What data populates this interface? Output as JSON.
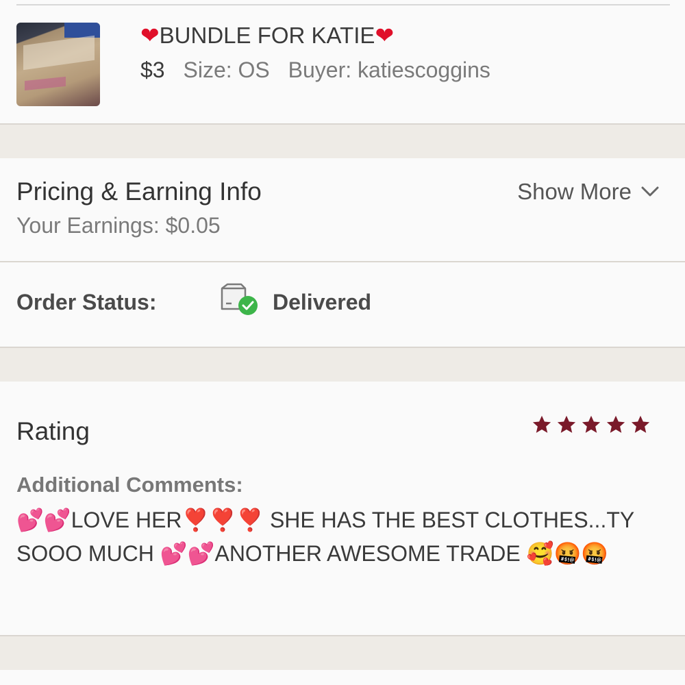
{
  "item": {
    "title": "BUNDLE FOR KATIE",
    "price": "$3",
    "size": "Size: OS",
    "buyer": "Buyer: katiescoggins"
  },
  "pricing": {
    "title": "Pricing & Earning Info",
    "earnings": "Your Earnings: $0.05",
    "show_more": "Show More"
  },
  "order_status": {
    "label": "Order Status:",
    "value": "Delivered"
  },
  "rating": {
    "title": "Rating",
    "stars": 5,
    "star_color": "#7a1a2a",
    "comments_label": "Additional Comments:",
    "comments": "💕💕LOVE HER❣️❣️❣️ SHE HAS THE BEST CLOTHES...TY SOOO MUCH 💕💕ANOTHER AWESOME TRADE 🥰🤬🤬"
  },
  "icons": {
    "heart": "❤",
    "status_icon": "package-delivered-icon",
    "chevron": "chevron-down-icon"
  },
  "colors": {
    "heart": "#e0102a",
    "status_check": "#3db54a",
    "background": "#eeebe6"
  }
}
